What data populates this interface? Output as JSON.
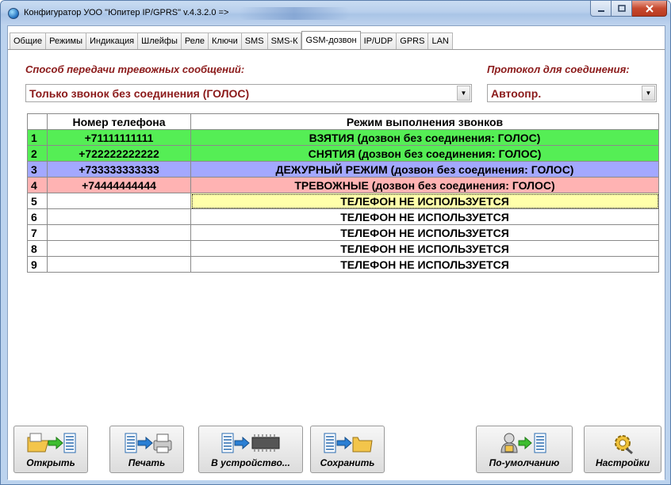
{
  "window": {
    "title": "Конфигуратор УОО \"Юпитер IP/GPRS\" v.4.3.2.0  =>"
  },
  "tabs": [
    {
      "label": "Общие",
      "active": false
    },
    {
      "label": "Режимы",
      "active": false
    },
    {
      "label": "Индикация",
      "active": false
    },
    {
      "label": "Шлейфы",
      "active": false
    },
    {
      "label": "Реле",
      "active": false
    },
    {
      "label": "Ключи",
      "active": false
    },
    {
      "label": "SMS",
      "active": false
    },
    {
      "label": "SMS-К",
      "active": false
    },
    {
      "label": "GSM-дозвон",
      "active": true
    },
    {
      "label": "IP/UDP",
      "active": false
    },
    {
      "label": "GPRS",
      "active": false
    },
    {
      "label": "LAN",
      "active": false
    }
  ],
  "form": {
    "method_label": "Способ передачи тревожных сообщений:",
    "method_value": "Только звонок без соединения (ГОЛОС)",
    "protocol_label": "Протокол для соединения:",
    "protocol_value": "Автоопр."
  },
  "table": {
    "headers": [
      "",
      "Номер телефона",
      "Режим выполнения звонков"
    ],
    "rows": [
      {
        "n": "1",
        "phone": "+71111111111",
        "mode": "ВЗЯТИЯ (дозвон без соединения: ГОЛОС)",
        "color": "green"
      },
      {
        "n": "2",
        "phone": "+722222222222",
        "mode": "СНЯТИЯ (дозвон без соединения: ГОЛОС)",
        "color": "green"
      },
      {
        "n": "3",
        "phone": "+733333333333",
        "mode": "ДЕЖУРНЫЙ РЕЖИМ (дозвон без соединения: ГОЛОС)",
        "color": "blue"
      },
      {
        "n": "4",
        "phone": "+74444444444",
        "mode": "ТРЕВОЖНЫЕ (дозвон без соединения: ГОЛОС)",
        "color": "red"
      },
      {
        "n": "5",
        "phone": "",
        "mode": "ТЕЛЕФОН НЕ ИСПОЛЬЗУЕТСЯ",
        "color": "white",
        "selected": true
      },
      {
        "n": "6",
        "phone": "",
        "mode": "ТЕЛЕФОН НЕ ИСПОЛЬЗУЕТСЯ",
        "color": "white"
      },
      {
        "n": "7",
        "phone": "",
        "mode": "ТЕЛЕФОН НЕ ИСПОЛЬЗУЕТСЯ",
        "color": "white"
      },
      {
        "n": "8",
        "phone": "",
        "mode": "ТЕЛЕФОН НЕ ИСПОЛЬЗУЕТСЯ",
        "color": "white"
      },
      {
        "n": "9",
        "phone": "",
        "mode": "ТЕЛЕФОН НЕ ИСПОЛЬЗУЕТСЯ",
        "color": "white"
      }
    ]
  },
  "buttons": {
    "open": "Открыть",
    "print": "Печать",
    "to_device": "В устройство...",
    "save": "Сохранить",
    "defaults": "По-умолчанию",
    "settings": "Настройки"
  },
  "colors": {
    "label_red": "#8b1a1a",
    "row_green": "#55ee55",
    "row_blue": "#a3a8ff",
    "row_red": "#ffb3b3",
    "row_selected": "#ffffaa"
  }
}
